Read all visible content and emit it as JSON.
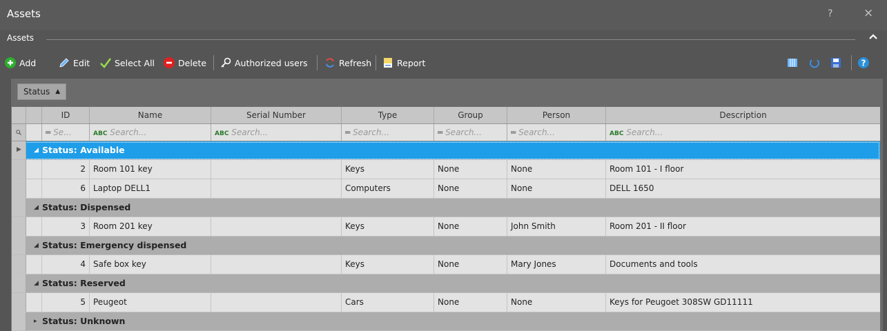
{
  "window": {
    "title": "Assets",
    "help_glyph": "?",
    "close_glyph": "×"
  },
  "section": {
    "label": "Assets",
    "collapse_glyph": "^"
  },
  "toolbar": {
    "add": "Add",
    "edit": "Edit",
    "select_all": "Select All",
    "delete": "Delete",
    "authorized_users": "Authorized users",
    "refresh": "Refresh",
    "report": "Report"
  },
  "group_chip": {
    "label": "Status",
    "sort_glyph": "▲"
  },
  "columns": {
    "id": "ID",
    "name": "Name",
    "serial": "Serial Number",
    "type": "Type",
    "group": "Group",
    "person": "Person",
    "description": "Description"
  },
  "filters": {
    "id": "Se...",
    "name": "Search...",
    "serial": "Search...",
    "type": "Search...",
    "group": "Search...",
    "person": "Search...",
    "description": "Search...",
    "eq_glyph": "═",
    "abc_glyph": "ABC"
  },
  "groups": [
    {
      "label": "Status: Available",
      "expanded": "◢"
    },
    {
      "label": "Status: Dispensed",
      "expanded": "◢"
    },
    {
      "label": "Status: Emergency dispensed",
      "expanded": "◢"
    },
    {
      "label": "Status: Reserved",
      "expanded": "◢"
    },
    {
      "label": "Status: Unknown",
      "expanded": "▸"
    }
  ],
  "rows": [
    {
      "id": "2",
      "name": "Room 101  key",
      "serial": "",
      "type": "Keys",
      "group": "None",
      "person": "None",
      "description": "Room 101 - I floor"
    },
    {
      "id": "6",
      "name": "Laptop DELL1",
      "serial": "",
      "type": "Computers",
      "group": "None",
      "person": "None",
      "description": "DELL 1650"
    },
    {
      "id": "3",
      "name": "Room 201 key",
      "serial": "",
      "type": "Keys",
      "group": "None",
      "person": "John Smith",
      "description": "Room 201 - II floor"
    },
    {
      "id": "4",
      "name": "Safe box key",
      "serial": "",
      "type": "Keys",
      "group": "None",
      "person": "Mary Jones",
      "description": "Documents and tools"
    },
    {
      "id": "5",
      "name": "Peugeot",
      "serial": "",
      "type": "Cars",
      "group": "None",
      "person": "None",
      "description": "Keys for  Peugoet 308SW GD11111"
    }
  ],
  "colors": {
    "accent": "#1e9de8",
    "add": "#2fae2f",
    "delete": "#e02020",
    "help": "#2a8fd8"
  }
}
